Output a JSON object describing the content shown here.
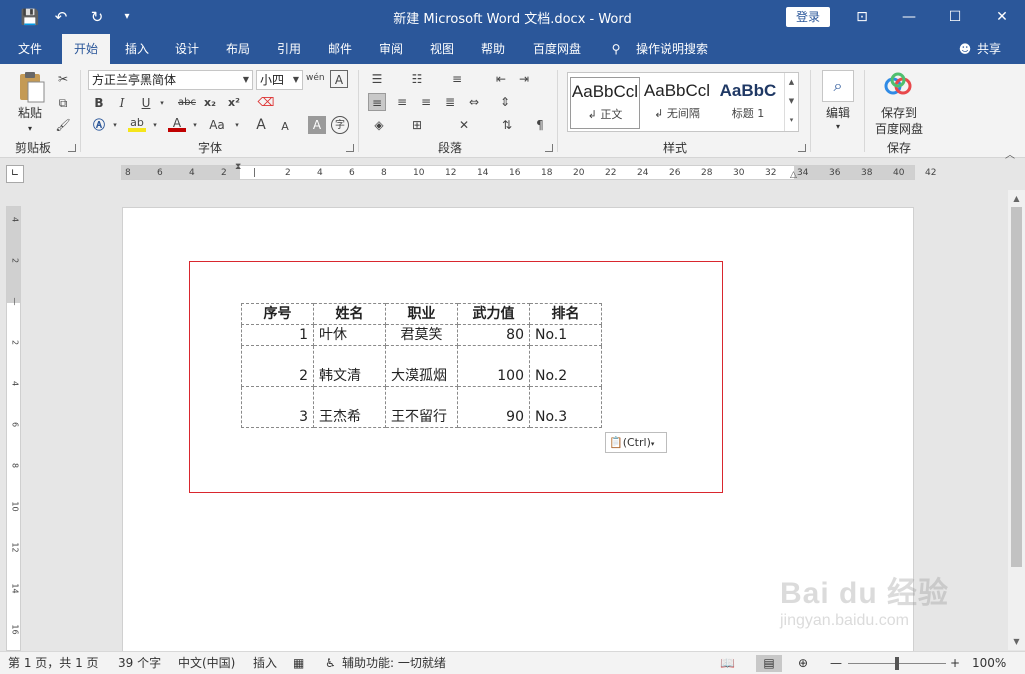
{
  "titlebar": {
    "title": "新建 Microsoft Word 文档.docx  -  Word",
    "login": "登录",
    "quick_access": {
      "save": "💾",
      "undo": "↶",
      "redo": "↻",
      "customize": "▾"
    },
    "window": {
      "ribbon_display": "⊡",
      "minimize": "—",
      "maximize": "☐",
      "close": "✕"
    }
  },
  "tabs": [
    "文件",
    "开始",
    "插入",
    "设计",
    "布局",
    "引用",
    "邮件",
    "审阅",
    "视图",
    "帮助",
    "百度网盘"
  ],
  "tell_me": "操作说明搜索",
  "share": "共享",
  "ribbon": {
    "clipboard": {
      "label": "剪贴板",
      "paste": "粘贴"
    },
    "font": {
      "label": "字体",
      "font_name": "方正兰亭黑简体",
      "font_size": "小四",
      "pinyin": "wén",
      "bold": "B",
      "italic": "I",
      "underline": "U",
      "strike": "abc",
      "sub": "x₂",
      "sup": "x²",
      "grow": "A",
      "shrink": "A",
      "aa": "Aa",
      "char_border": "A",
      "enclose": "字"
    },
    "paragraph": {
      "label": "段落"
    },
    "styles": {
      "label": "样式",
      "items": [
        {
          "preview": "AaBbCcl",
          "name": "↲ 正文"
        },
        {
          "preview": "AaBbCcl",
          "name": "↲ 无间隔"
        },
        {
          "preview": "AaBbC",
          "name": "标题 1"
        }
      ]
    },
    "editing": {
      "label": "编辑"
    },
    "save": {
      "label": "保存",
      "button_line1": "保存到",
      "button_line2": "百度网盘"
    }
  },
  "ruler": {
    "h_marks": [
      "8",
      "6",
      "4",
      "2",
      "",
      "2",
      "4",
      "6",
      "8",
      "10",
      "12",
      "14",
      "16",
      "18",
      "20",
      "22",
      "24",
      "26",
      "28",
      "30",
      "32",
      "34",
      "36",
      "38",
      "40",
      "42"
    ],
    "v_marks": [
      "4",
      "2",
      "",
      "2",
      "4",
      "6",
      "8",
      "10",
      "12",
      "14",
      "16"
    ]
  },
  "table": {
    "headers": [
      "序号",
      "姓名",
      "职业",
      "武力值",
      "排名"
    ],
    "rows": [
      {
        "id": "1",
        "name": "叶休",
        "job": "君莫笑",
        "power": "80",
        "rank": "No.1"
      },
      {
        "id": "2",
        "name": "韩文清",
        "job": "大漠孤烟",
        "power": "100",
        "rank": "No.2"
      },
      {
        "id": "3",
        "name": "王杰希",
        "job": "王不留行",
        "power": "90",
        "rank": "No.3"
      }
    ]
  },
  "paste_options": "(Ctrl)",
  "watermark": {
    "brand": "Bai du 经验",
    "url": "jingyan.baidu.com"
  },
  "statusbar": {
    "page": "第 1 页，共 1 页",
    "words": "39 个字",
    "language": "中文(中国)",
    "mode": "插入",
    "accessibility": "辅助功能: 一切就绪",
    "zoom": "100%"
  },
  "colors": {
    "accent": "#2b579a",
    "highlight": "#f5e51b",
    "font_color": "#c00000",
    "selection_box": "#d9272e"
  }
}
